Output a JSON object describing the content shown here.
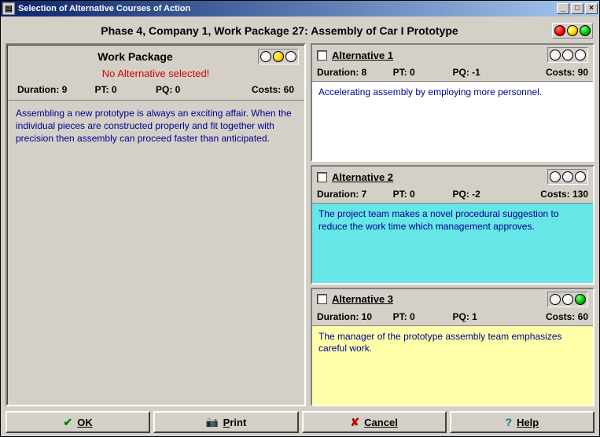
{
  "window": {
    "title": "Selection of Alternative Courses of Action"
  },
  "header": {
    "title": "Phase 4, Company 1, Work Package 27: Assembly of Car I Prototype",
    "lights": [
      "red",
      "yellow",
      "green"
    ]
  },
  "work_package": {
    "title": "Work Package",
    "no_alt_msg": "No Alternative selected!",
    "duration_label": "Duration:",
    "duration": "9",
    "pt_label": "PT:",
    "pt": "0",
    "pq_label": "PQ:",
    "pq": "0",
    "costs_label": "Costs:",
    "costs": "60",
    "lights": [
      "off",
      "yellow",
      "off"
    ],
    "description": "Assembling a new prototype is always an exciting affair. When the individual pieces are constructed properly and fit together with precision then assembly can proceed faster than anticipated."
  },
  "alternatives": [
    {
      "name": "Alternative 1",
      "duration_label": "Duration:",
      "duration": "8",
      "pt_label": "PT:",
      "pt": "0",
      "pq_label": "PQ:",
      "pq": "-1",
      "costs_label": "Costs:",
      "costs": "90",
      "lights": [
        "off",
        "off",
        "off"
      ],
      "description": "Accelerating assembly by employing more personnel."
    },
    {
      "name": "Alternative 2",
      "duration_label": "Duration:",
      "duration": "7",
      "pt_label": "PT:",
      "pt": "0",
      "pq_label": "PQ:",
      "pq": "-2",
      "costs_label": "Costs:",
      "costs": "130",
      "lights": [
        "off",
        "off",
        "off"
      ],
      "description": "The project team makes a novel procedural suggestion to reduce the work time which management approves."
    },
    {
      "name": "Alternative 3",
      "duration_label": "Duration:",
      "duration": "10",
      "pt_label": "PT:",
      "pt": "0",
      "pq_label": "PQ:",
      "pq": "1",
      "costs_label": "Costs:",
      "costs": "60",
      "lights": [
        "off",
        "off",
        "green"
      ],
      "description": "The manager of the prototype assembly team emphasizes careful work."
    }
  ],
  "buttons": {
    "ok": "OK",
    "print": "Print",
    "cancel": "Cancel",
    "help": "Help"
  }
}
